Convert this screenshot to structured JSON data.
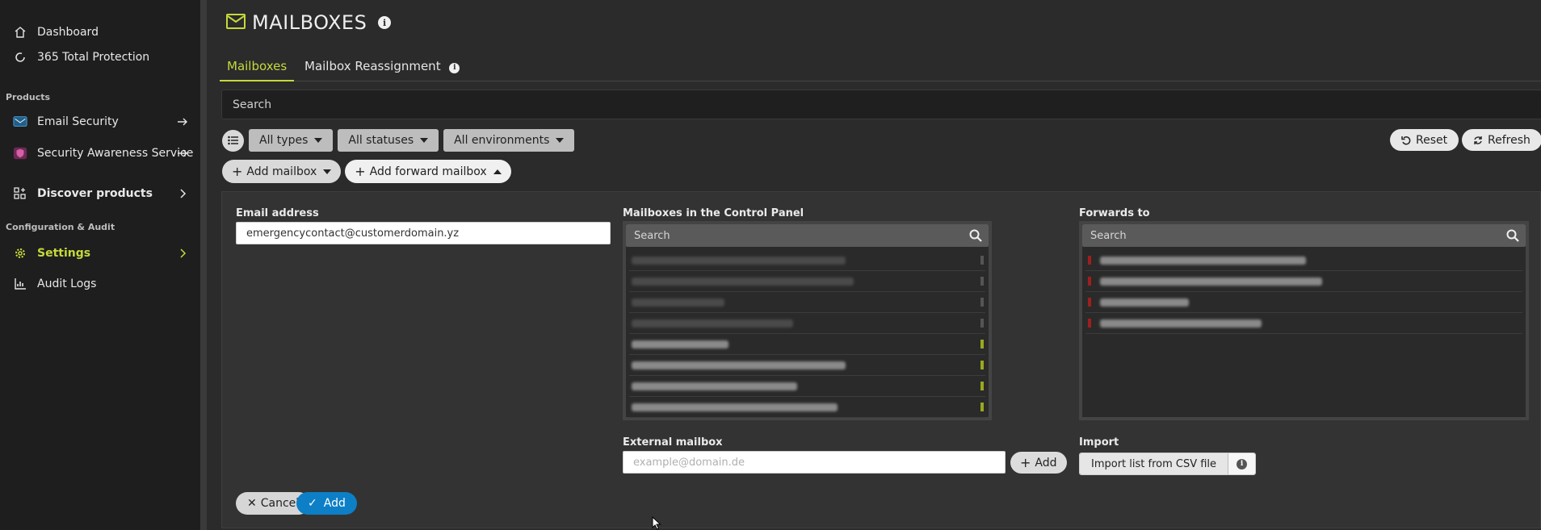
{
  "sidebar": {
    "items_top": [
      {
        "label": "Dashboard",
        "icon": "home-icon"
      },
      {
        "label": "365 Total Protection",
        "icon": "refresh-circle-icon"
      }
    ],
    "products_heading": "Products",
    "products": [
      {
        "label": "Email Security",
        "icon": "email-security-icon"
      },
      {
        "label": "Security Awareness Service",
        "icon": "shield-user-icon"
      }
    ],
    "discover": {
      "label": "Discover products",
      "icon": "grid-plus-icon"
    },
    "config_heading": "Configuration & Audit",
    "config": [
      {
        "label": "Settings",
        "icon": "gear-icon"
      },
      {
        "label": "Audit Logs",
        "icon": "chart-icon"
      }
    ]
  },
  "header": {
    "title": "MAILBOXES",
    "accent": "#c6d93a"
  },
  "tabs": [
    {
      "label": "Mailboxes"
    },
    {
      "label": "Mailbox Reassignment"
    }
  ],
  "search": {
    "placeholder": "Search"
  },
  "filters": {
    "types": "All types",
    "statuses": "All statuses",
    "environments": "All environments",
    "reset": "Reset",
    "refresh": "Refresh"
  },
  "actions": {
    "add_mailbox": "Add mailbox",
    "add_forward": "Add forward mailbox"
  },
  "form": {
    "email_label": "Email address",
    "email_value": "emergencycontact@customerdomain.yz",
    "control_panel_label": "Mailboxes in the Control Panel",
    "control_panel_search": "Search",
    "forwards_label": "Forwards to",
    "forwards_search": "Search",
    "external_label": "External mailbox",
    "external_placeholder": "example@domain.de",
    "external_add": "Add",
    "import_label": "Import",
    "import_button": "Import list from CSV file",
    "cancel": "Cancel",
    "add": "Add",
    "primary_color": "#0d7fc6"
  }
}
